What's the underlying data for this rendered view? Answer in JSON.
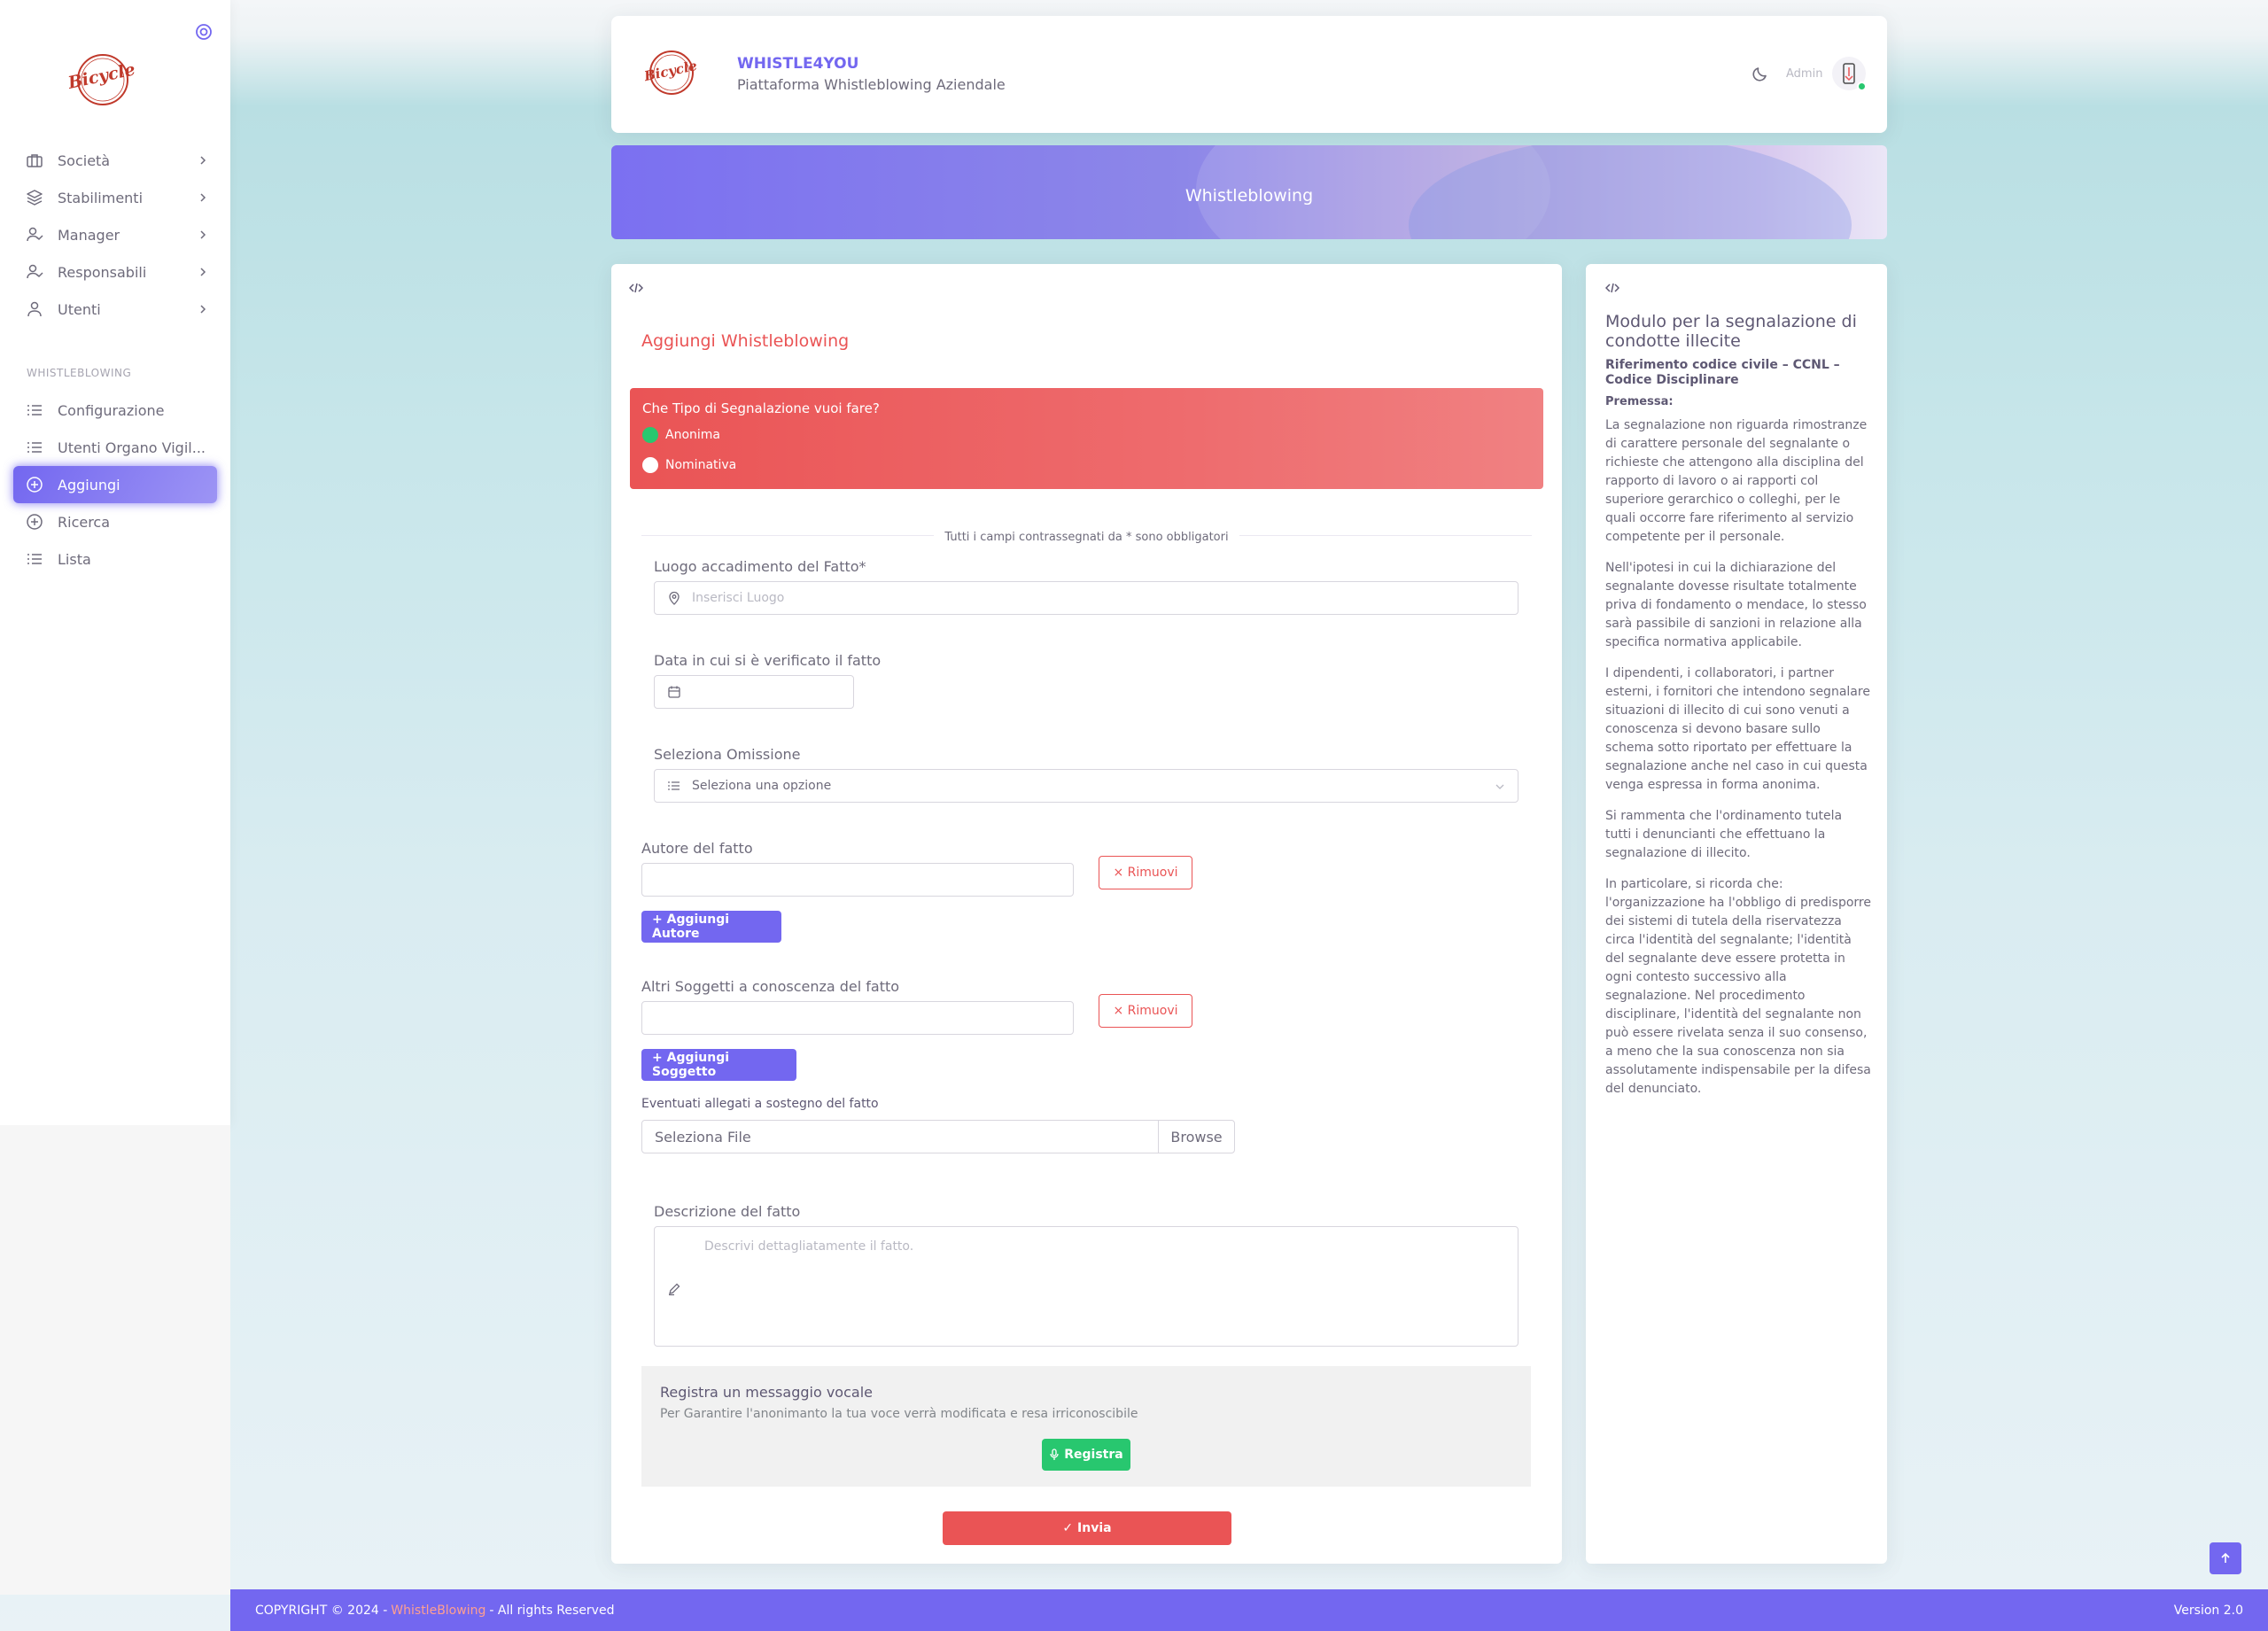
{
  "sidebar": {
    "nav_items": [
      {
        "label": "Società",
        "icon": "briefcase-icon"
      },
      {
        "label": "Stabilimenti",
        "icon": "layers-icon"
      },
      {
        "label": "Manager",
        "icon": "user-check-icon"
      },
      {
        "label": "Responsabili",
        "icon": "user-check-icon"
      },
      {
        "label": "Utenti",
        "icon": "user-icon"
      }
    ],
    "section_label": "WHISTLEBLOWING",
    "section_items": [
      {
        "label": "Configurazione",
        "icon": "list-icon"
      },
      {
        "label": "Utenti Organo Vigil...",
        "icon": "list-icon"
      },
      {
        "label": "Aggiungi",
        "icon": "plus-circle-icon",
        "active": true
      },
      {
        "label": "Ricerca",
        "icon": "plus-circle-icon"
      },
      {
        "label": "Lista",
        "icon": "list-icon"
      }
    ]
  },
  "header": {
    "title": "WHISTLE4YOU",
    "subtitle": "Piattaforma Whistleblowing Aziendale",
    "user_name": "Admin"
  },
  "banner": {
    "title": "Whistleblowing"
  },
  "form": {
    "title": "Aggiungi Whistleblowing",
    "type_question": "Che Tipo di Segnalazione vuoi fare?",
    "type_options": [
      {
        "label": "Anonima",
        "selected": true
      },
      {
        "label": "Nominativa",
        "selected": false
      }
    ],
    "required_note": "Tutti i campi contrassegnati da * sono obbligatori",
    "place_label": "Luogo accadimento del Fatto*",
    "place_placeholder": "Inserisci Luogo",
    "date_label": "Data in cui si è verificato il fatto",
    "omission_label": "Seleziona Omissione",
    "omission_value": "Seleziona una opzione",
    "author_label": "Autore del fatto",
    "remove_label": "× Rimuovi",
    "add_author_label": "+ Aggiungi Autore",
    "others_label": "Altri Soggetti a conoscenza del fatto",
    "add_subject_label": "+ Aggiungi Soggetto",
    "attachments_label": "Eventuati allegati a sostegno del fatto",
    "file_placeholder": "Seleziona File",
    "browse_label": "Browse",
    "description_label": "Descrizione del fatto",
    "description_placeholder": "Descrivi dettagliatamente il fatto.",
    "voice_title": "Registra un messaggio vocale",
    "voice_subtitle": "Per Garantire l'anonimanto la tua voce verrà modificata e resa irriconoscibile",
    "record_label": "Registra",
    "submit_label": "✓ Invia"
  },
  "info": {
    "title": "Modulo per la segnalazione di condotte illecite",
    "reference": "Riferimento codice civile – CCNL – Codice Disciplinare",
    "premise_label": "Premessa:",
    "paragraphs": [
      "La segnalazione non riguarda rimostranze di carattere personale del segnalante o richieste che attengono alla disciplina del rapporto di lavoro o ai rapporti col superiore gerarchico o colleghi, per le quali occorre fare riferimento al servizio competente per il personale.",
      "Nell'ipotesi in cui la dichiarazione del segnalante dovesse risultate totalmente priva di fondamento o mendace, lo stesso sarà passibile di sanzioni in relazione alla specifica normativa applicabile.",
      "I dipendenti, i collaboratori, i partner esterni, i fornitori che intendono segnalare situazioni di illecito di cui sono venuti a conoscenza si devono basare sullo schema sotto riportato per effettuare la segnalazione anche nel caso in cui questa venga espressa in forma anonima.",
      "Si rammenta che l'ordinamento tutela tutti i denuncianti che effettuano la segnalazione di illecito.",
      "In particolare, si ricorda che: l'organizzazione ha l'obbligo di predisporre dei sistemi di tutela della riservatezza circa l'identità del segnalante; l'identità del segnalante deve essere protetta in ogni contesto successivo alla segnalazione. Nel procedimento disciplinare, l'identità del segnalante non può essere rivelata senza il suo consenso, a meno che la sua conoscenza non sia assolutamente indispensabile per la difesa del denunciato."
    ]
  },
  "footer": {
    "copyright_prefix": "COPYRIGHT © 2024 -",
    "brand": "WhistleBlowing",
    "copyright_suffix": "- All rights Reserved",
    "version": "Version 2.0"
  },
  "colors": {
    "primary": "#7367f0",
    "danger": "#ea5455",
    "success": "#28c76f"
  }
}
